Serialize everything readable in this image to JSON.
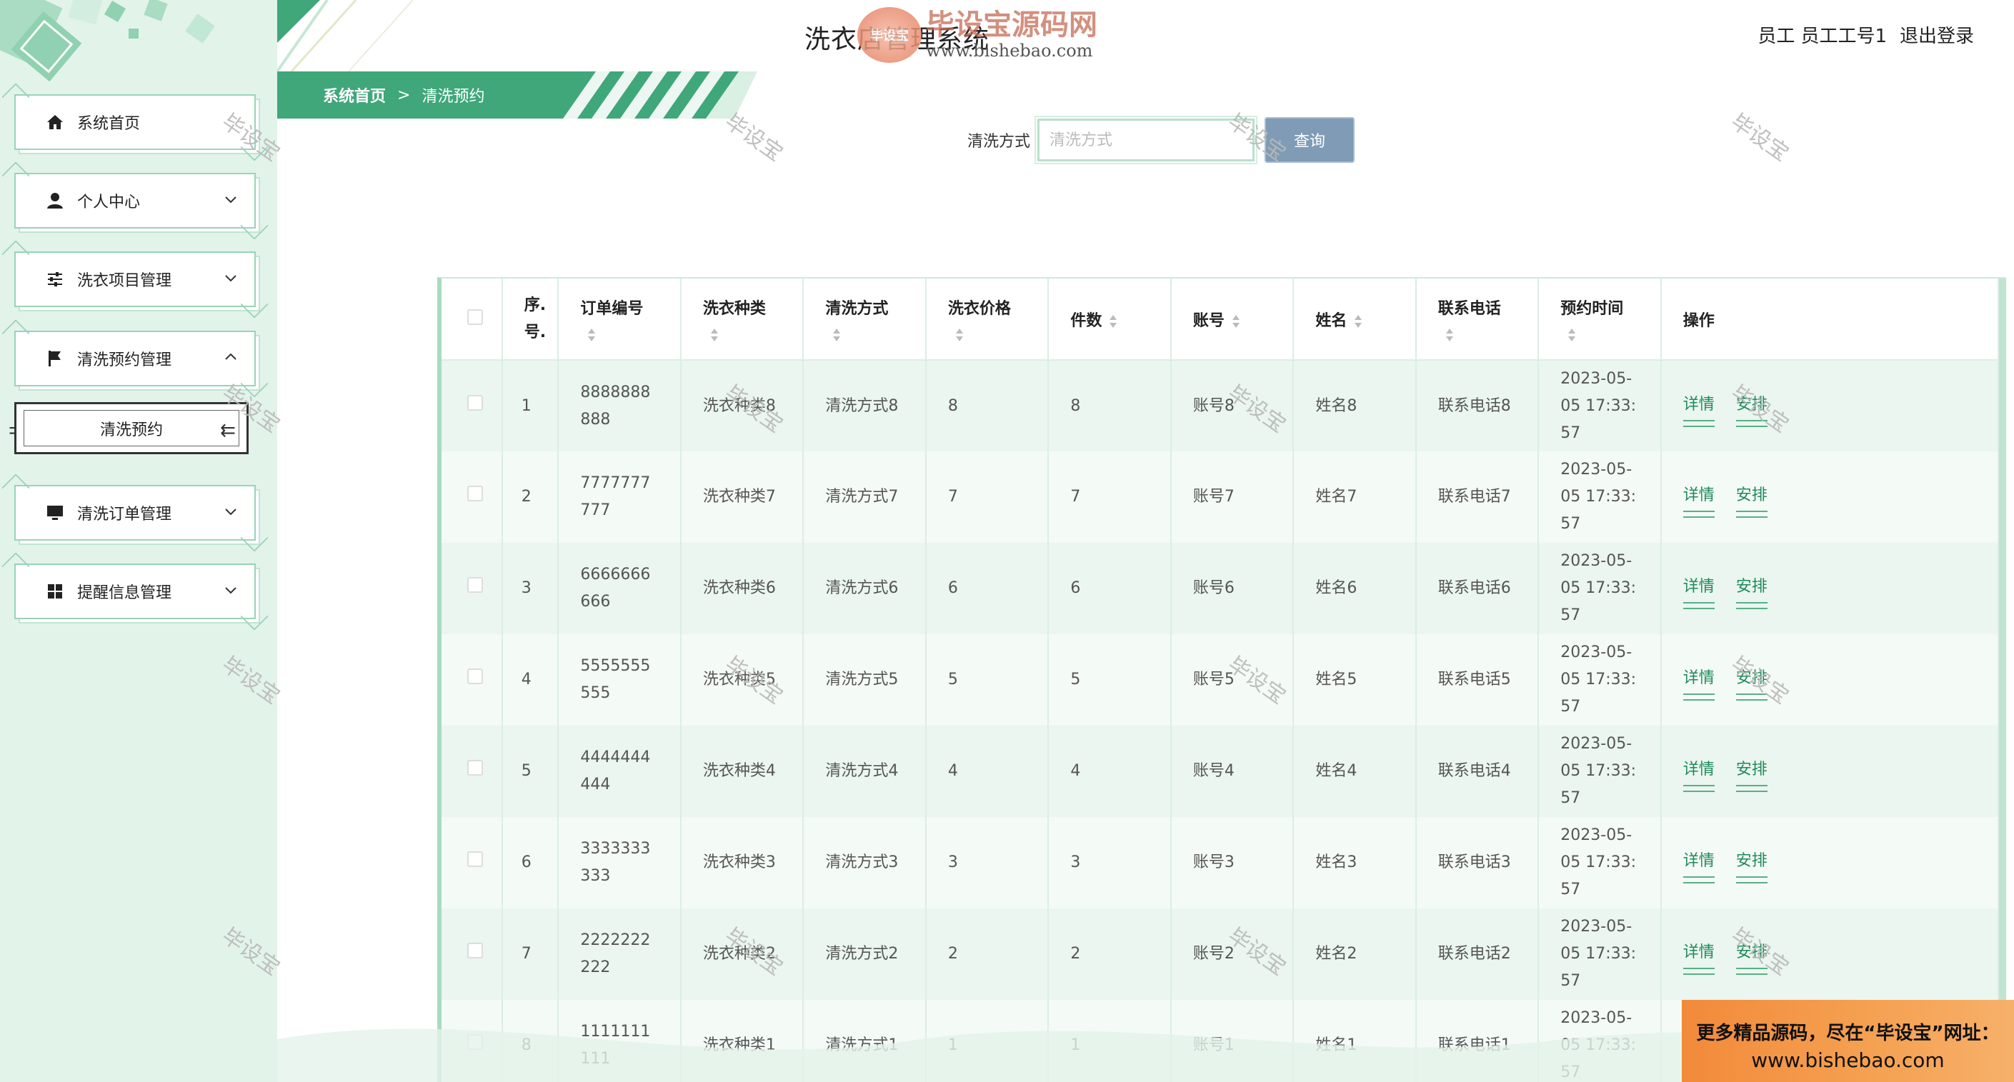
{
  "app_title": "洗衣店管理系统",
  "watermark": {
    "logo_badge": "毕设宝",
    "site_name": "毕设宝源码网",
    "site_url": "www.bishebao.com",
    "tag": "毕设宝"
  },
  "user_area": {
    "role": "员工",
    "username": "员工工号1",
    "logout_label": "退出登录"
  },
  "sidebar": {
    "items": [
      {
        "label": "系统首页",
        "icon": "home-icon",
        "expanded": null
      },
      {
        "label": "个人中心",
        "icon": "user-icon",
        "expanded": false
      },
      {
        "label": "洗衣项目管理",
        "icon": "sliders-icon",
        "expanded": false
      },
      {
        "label": "清洗预约管理",
        "icon": "flag-icon",
        "expanded": true
      },
      {
        "label": "清洗订单管理",
        "icon": "monitor-icon",
        "expanded": false
      },
      {
        "label": "提醒信息管理",
        "icon": "grid-icon",
        "expanded": false
      }
    ],
    "sub_item": {
      "label": "清洗预约",
      "selected": true
    }
  },
  "breadcrumb": {
    "home": "系统首页",
    "separator": ">",
    "current": "清洗预约"
  },
  "search": {
    "label": "清洗方式",
    "placeholder": "清洗方式",
    "value": "",
    "button_label": "查询"
  },
  "table": {
    "columns": [
      "序号",
      "订单编号",
      "洗衣种类",
      "清洗方式",
      "洗衣价格",
      "件数",
      "账号",
      "姓名",
      "联系电话",
      "预约时间",
      "操作"
    ],
    "header_lines": {
      "index_line1": "序.",
      "index_line2": "号."
    },
    "rows": [
      {
        "index": "1",
        "order_no": "8888888888",
        "order_no_l1": "8888888",
        "order_no_l2": "888",
        "type": "洗衣种类8",
        "method": "清洗方式8",
        "price": "8",
        "qty": "8",
        "account": "账号8",
        "name": "姓名8",
        "phone": "联系电话8",
        "time_l1": "2023-05-",
        "time_l2": "05 17:33:",
        "time_l3": "57"
      },
      {
        "index": "2",
        "order_no": "7777777777",
        "order_no_l1": "7777777",
        "order_no_l2": "777",
        "type": "洗衣种类7",
        "method": "清洗方式7",
        "price": "7",
        "qty": "7",
        "account": "账号7",
        "name": "姓名7",
        "phone": "联系电话7",
        "time_l1": "2023-05-",
        "time_l2": "05 17:33:",
        "time_l3": "57"
      },
      {
        "index": "3",
        "order_no": "6666666666",
        "order_no_l1": "6666666",
        "order_no_l2": "666",
        "type": "洗衣种类6",
        "method": "清洗方式6",
        "price": "6",
        "qty": "6",
        "account": "账号6",
        "name": "姓名6",
        "phone": "联系电话6",
        "time_l1": "2023-05-",
        "time_l2": "05 17:33:",
        "time_l3": "57"
      },
      {
        "index": "4",
        "order_no": "5555555555",
        "order_no_l1": "5555555",
        "order_no_l2": "555",
        "type": "洗衣种类5",
        "method": "清洗方式5",
        "price": "5",
        "qty": "5",
        "account": "账号5",
        "name": "姓名5",
        "phone": "联系电话5",
        "time_l1": "2023-05-",
        "time_l2": "05 17:33:",
        "time_l3": "57"
      },
      {
        "index": "5",
        "order_no": "4444444444",
        "order_no_l1": "4444444",
        "order_no_l2": "444",
        "type": "洗衣种类4",
        "method": "清洗方式4",
        "price": "4",
        "qty": "4",
        "account": "账号4",
        "name": "姓名4",
        "phone": "联系电话4",
        "time_l1": "2023-05-",
        "time_l2": "05 17:33:",
        "time_l3": "57"
      },
      {
        "index": "6",
        "order_no": "3333333333",
        "order_no_l1": "3333333",
        "order_no_l2": "333",
        "type": "洗衣种类3",
        "method": "清洗方式3",
        "price": "3",
        "qty": "3",
        "account": "账号3",
        "name": "姓名3",
        "phone": "联系电话3",
        "time_l1": "2023-05-",
        "time_l2": "05 17:33:",
        "time_l3": "57"
      },
      {
        "index": "7",
        "order_no": "2222222222",
        "order_no_l1": "2222222",
        "order_no_l2": "222",
        "type": "洗衣种类2",
        "method": "清洗方式2",
        "price": "2",
        "qty": "2",
        "account": "账号2",
        "name": "姓名2",
        "phone": "联系电话2",
        "time_l1": "2023-05-",
        "time_l2": "05 17:33:",
        "time_l3": "57"
      },
      {
        "index": "8",
        "order_no": "1111111111",
        "order_no_l1": "1111111",
        "order_no_l2": "111",
        "type": "洗衣种类1",
        "method": "清洗方式1",
        "price": "1",
        "qty": "1",
        "account": "账号1",
        "name": "姓名1",
        "phone": "联系电话1",
        "time_l1": "2023-05-",
        "time_l2": "05 17:33:",
        "time_l3": "57"
      }
    ],
    "actions": {
      "detail": "详情",
      "arrange": "安排"
    }
  },
  "ad": {
    "line1": "更多精品源码，尽在“毕设宝”网址：",
    "line2": "www.bishebao.com"
  },
  "colors": {
    "sidebar_bg": "#e2f3ea",
    "accent_green": "#3fa77a",
    "link_green": "#1f8a5b",
    "button_blue": "#7f9bb6",
    "row_stripe": "#eaf6ef"
  }
}
